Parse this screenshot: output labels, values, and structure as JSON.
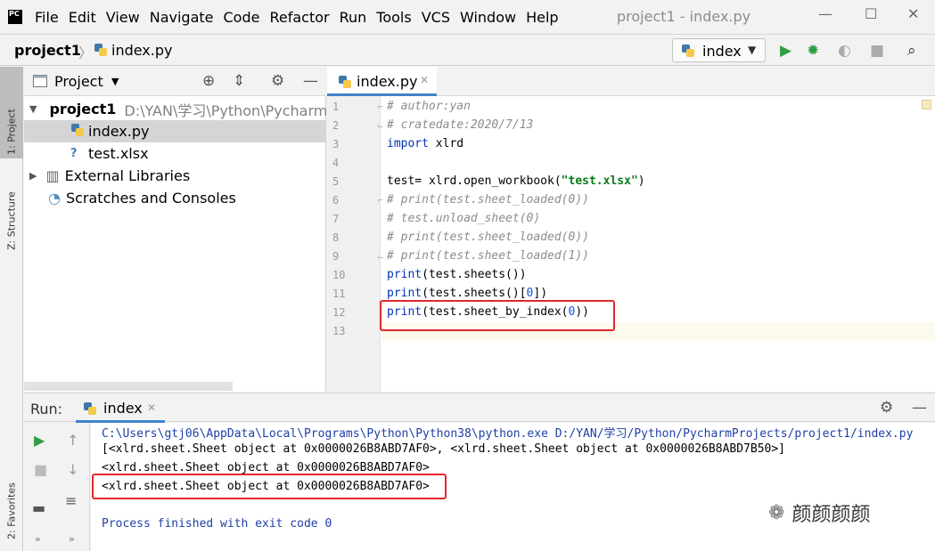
{
  "app": {
    "logo": "PC",
    "window_title": "project1 - index.py"
  },
  "menu": [
    "File",
    "Edit",
    "View",
    "Navigate",
    "Code",
    "Refactor",
    "Run",
    "Tools",
    "VCS",
    "Window",
    "Help"
  ],
  "navbar": {
    "project": "project1",
    "file": "index.py",
    "run_config": "index"
  },
  "side_tabs": {
    "project": "1: Project",
    "structure": "Z: Structure",
    "favorites": "2: Favorites"
  },
  "project_panel": {
    "title": "Project",
    "tree": [
      {
        "label": "project1",
        "path": "D:\\YAN\\学习\\Python\\Pycharm",
        "type": "root"
      },
      {
        "label": "index.py",
        "type": "py",
        "selected": true
      },
      {
        "label": "test.xlsx",
        "type": "unknown"
      },
      {
        "label": "External Libraries",
        "type": "libs"
      },
      {
        "label": "Scratches and Consoles",
        "type": "scratch"
      }
    ]
  },
  "editor": {
    "tab": "index.py",
    "lines": [
      "1",
      "2",
      "3",
      "4",
      "5",
      "6",
      "7",
      "8",
      "9",
      "10",
      "11",
      "12",
      "13"
    ],
    "code": {
      "l1": "# author:yan",
      "l2": "# cratedate:2020/7/13",
      "l3_kw": "import",
      "l3_rest": " xlrd",
      "l5_a": "test= xlrd.open_workbook(",
      "l5_str": "\"test.xlsx\"",
      "l5_b": ")",
      "l6": "# print(test.sheet_loaded(0))",
      "l7": "# test.unload_sheet(0)",
      "l8": "# print(test.sheet_loaded(0))",
      "l9": "# print(test.sheet_loaded(1))",
      "l10_kw": "print",
      "l10_rest": "(test.sheets())",
      "l11_kw": "print",
      "l11_a": "(test.sheets()[",
      "l11_num": "0",
      "l11_b": "])",
      "l12_kw": "print",
      "l12_a": "(test.sheet_by_index(",
      "l12_num": "0",
      "l12_b": "))"
    }
  },
  "run": {
    "label": "Run:",
    "tab": "index",
    "output": [
      "C:\\Users\\gtj06\\AppData\\Local\\Programs\\Python\\Python38\\python.exe D:/YAN/学习/Python/PycharmProjects/project1/index.py",
      "[<xlrd.sheet.Sheet object at 0x0000026B8ABD7AF0>, <xlrd.sheet.Sheet object at 0x0000026B8ABD7B50>]",
      "<xlrd.sheet.Sheet object at 0x0000026B8ABD7AF0>",
      "<xlrd.sheet.Sheet object at 0x0000026B8ABD7AF0>",
      "",
      "Process finished with exit code 0"
    ]
  },
  "watermark": "颜颜颜颜",
  "colors": {
    "accent": "#4083c9",
    "highlight": "#e4262d",
    "run_green": "#2f9e44"
  }
}
